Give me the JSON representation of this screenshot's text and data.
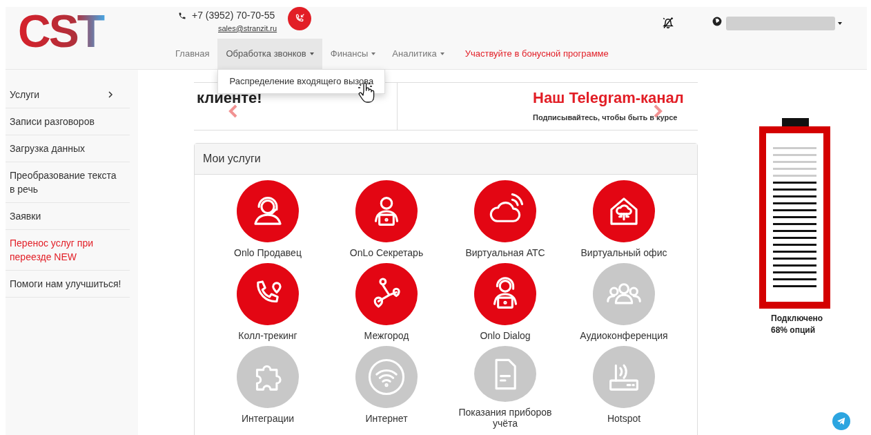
{
  "header": {
    "logo": "CST",
    "phone": "+7 (3952) 70-70-55",
    "email": "sales@stranzit.ru",
    "nav": [
      {
        "label": "Главная",
        "kind": "link",
        "selected": false
      },
      {
        "label": "Обработка звонков",
        "kind": "menu",
        "selected": true,
        "menu_items": [
          "Распределение входящего вызова"
        ]
      },
      {
        "label": "Финансы",
        "kind": "menu",
        "selected": false
      },
      {
        "label": "Аналитика",
        "kind": "menu",
        "selected": false
      },
      {
        "label": "Участвуйте в бонусной программе",
        "kind": "promo",
        "selected": false
      }
    ]
  },
  "sidebar": {
    "items": [
      {
        "label": "Услуги",
        "has_submenu": true,
        "highlighted": false
      },
      {
        "label": "Записи разговоров",
        "has_submenu": false,
        "highlighted": false
      },
      {
        "label": "Загрузка данных",
        "has_submenu": false,
        "highlighted": false
      },
      {
        "label": "Преобразование текста в речь",
        "has_submenu": false,
        "highlighted": false
      },
      {
        "label": "Заявки",
        "has_submenu": false,
        "highlighted": false
      },
      {
        "label": "Перенос услуг при переезде NEW",
        "has_submenu": false,
        "highlighted": true
      },
      {
        "label": "Помоги нам улучшиться!",
        "has_submenu": false,
        "highlighted": false
      }
    ]
  },
  "carousel": {
    "slides": [
      {
        "kind": "plain",
        "title": "клиенте!"
      },
      {
        "kind": "headline",
        "title": "Наш Telegram-канал",
        "subtitle": "Подписывайтесь, чтобы быть в курсе"
      }
    ]
  },
  "services": {
    "title": "Мои услуги",
    "items": [
      {
        "label": "Onlo Продавец",
        "active": true
      },
      {
        "label": "OnLo Секретарь",
        "active": true
      },
      {
        "label": "Виртуальная АТС",
        "active": true
      },
      {
        "label": "Виртуальный офис",
        "active": true
      },
      {
        "label": "Колл-трекинг",
        "active": true
      },
      {
        "label": "Межгород",
        "active": true
      },
      {
        "label": "Onlo Dialog",
        "active": true
      },
      {
        "label": "Аудиоконференция",
        "active": false
      },
      {
        "label": "Интеграции",
        "active": false
      },
      {
        "label": "Интернет",
        "active": false
      },
      {
        "label": "Показания приборов учёта",
        "active": false
      },
      {
        "label": "Hotspot",
        "active": false
      }
    ]
  },
  "battery": {
    "level": 0.74,
    "caption": "Подключено 68% опций"
  }
}
